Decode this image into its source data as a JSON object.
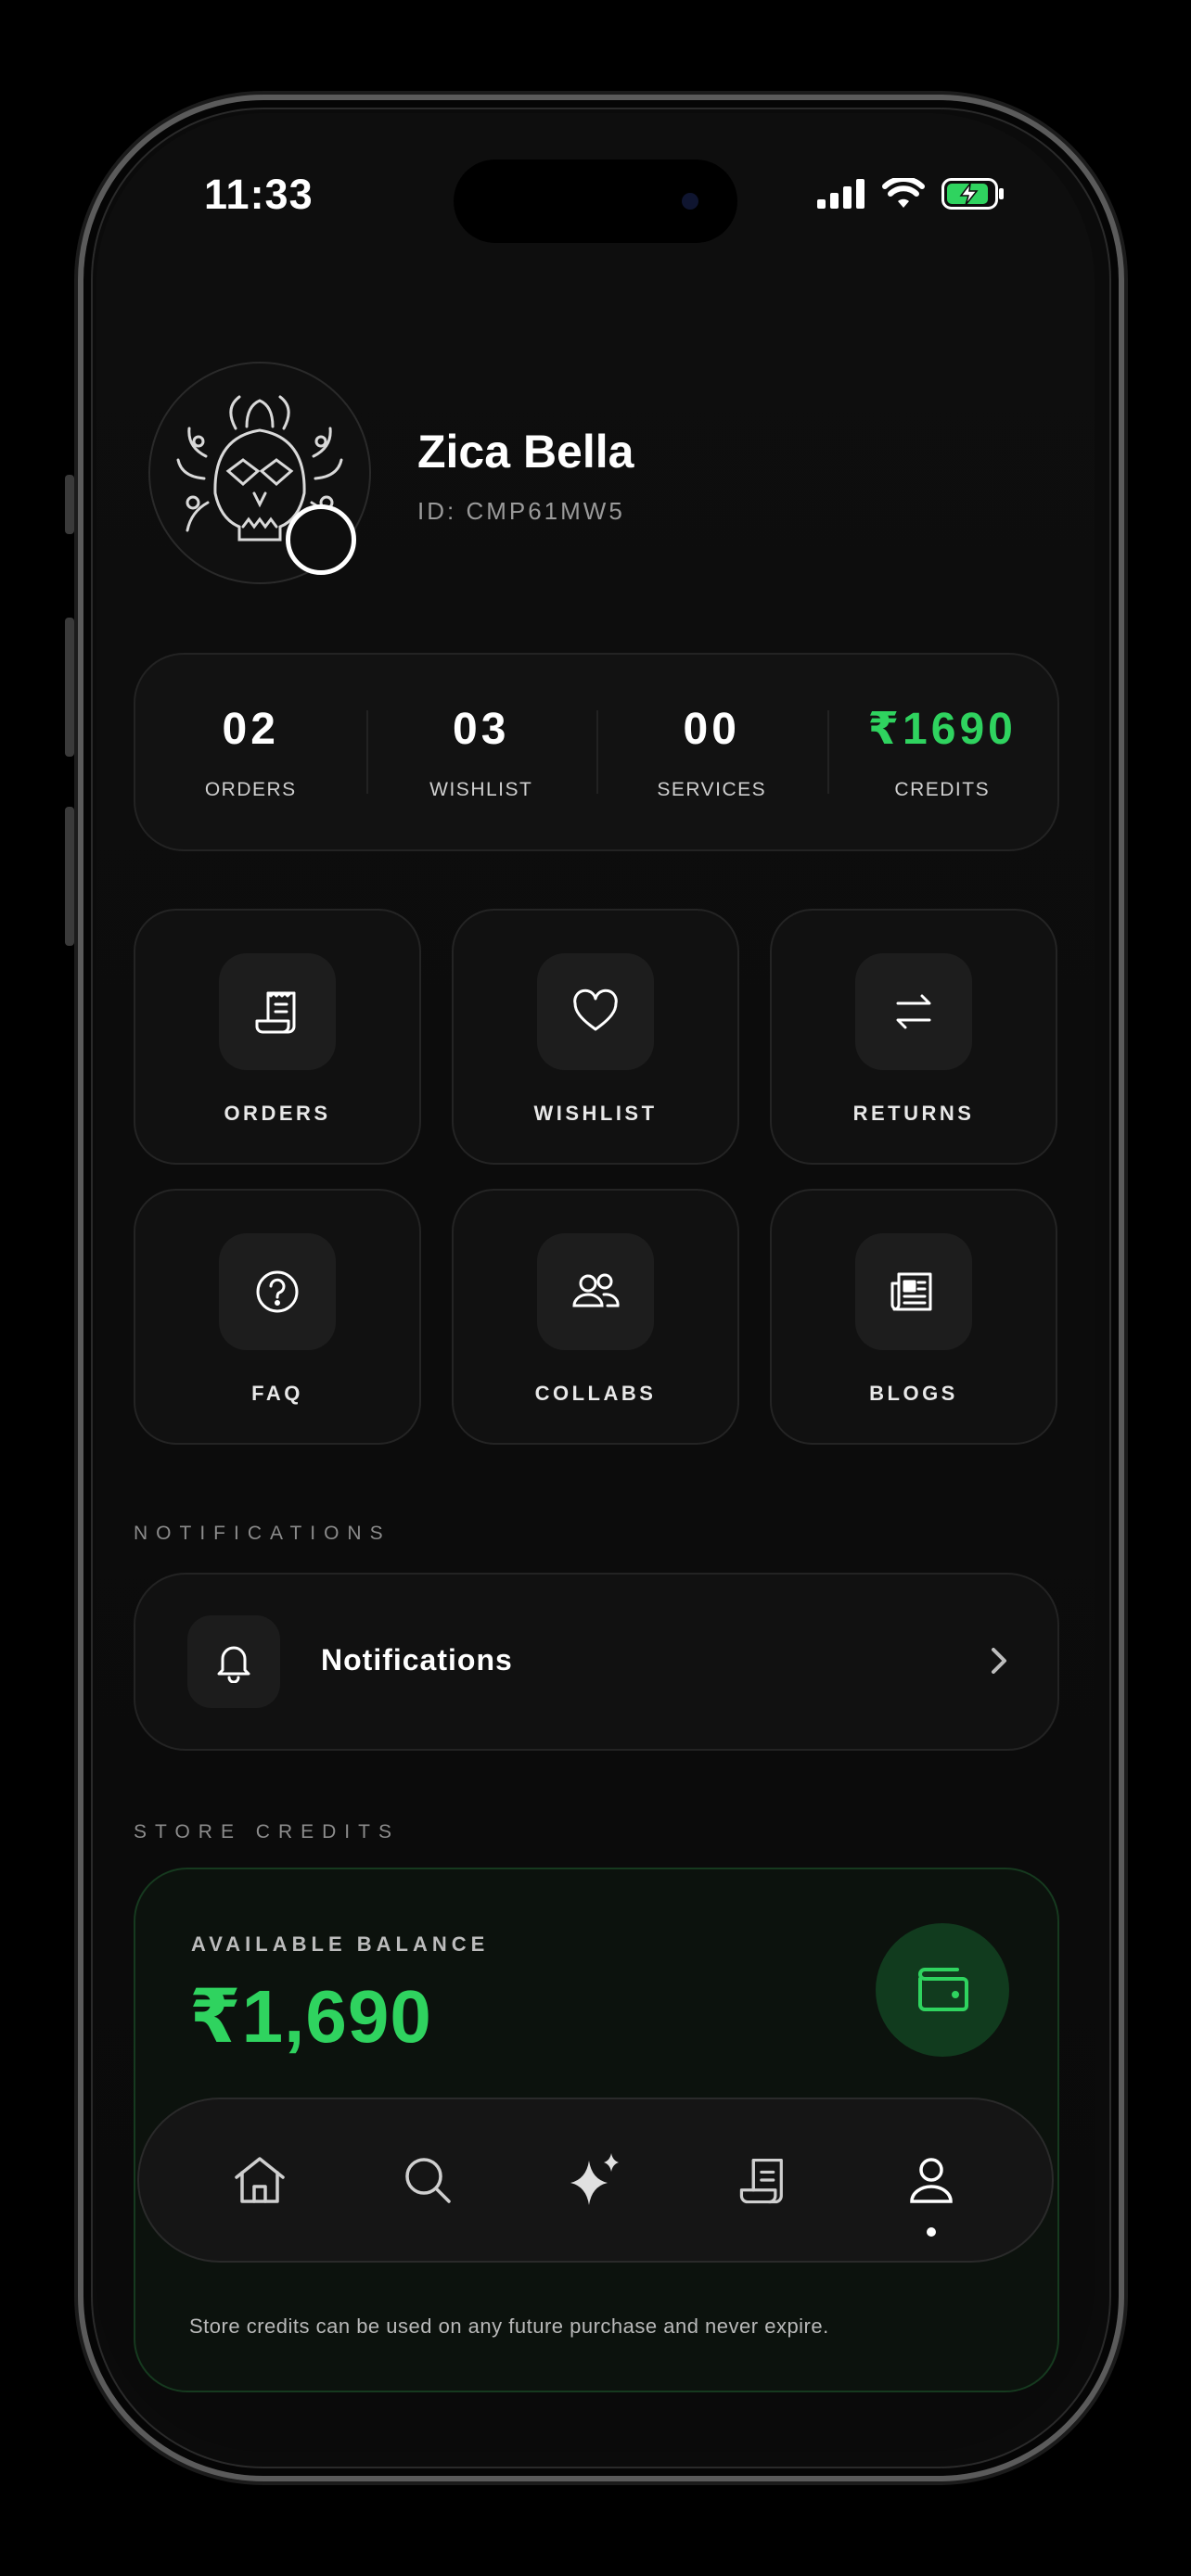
{
  "status_bar": {
    "time": "11:33"
  },
  "profile": {
    "name": "Zica Bella",
    "id": "ID: CMP61MW5"
  },
  "stats": [
    {
      "value": "02",
      "label": "ORDERS"
    },
    {
      "value": "03",
      "label": "WISHLIST"
    },
    {
      "value": "00",
      "label": "SERVICES"
    },
    {
      "value": "₹1690",
      "label": "CREDITS"
    }
  ],
  "tiles": [
    {
      "label": "ORDERS",
      "icon": "receipt-icon"
    },
    {
      "label": "WISHLIST",
      "icon": "heart-icon"
    },
    {
      "label": "RETURNS",
      "icon": "swap-arrows-icon"
    },
    {
      "label": "FAQ",
      "icon": "question-circle-icon"
    },
    {
      "label": "COLLABS",
      "icon": "users-icon"
    },
    {
      "label": "BLOGS",
      "icon": "newspaper-icon"
    }
  ],
  "notifications": {
    "section_title": "NOTIFICATIONS",
    "row_label": "Notifications"
  },
  "store_credits": {
    "section_title": "STORE CREDITS",
    "available_label": "AVAILABLE BALANCE",
    "balance": "₹1,690",
    "note": "Store credits can be used on any future purchase and never expire."
  },
  "tab_bar": {
    "items": [
      "home-icon",
      "search-icon",
      "sparkles-icon",
      "receipt-icon",
      "profile-icon"
    ],
    "active_index": 4
  },
  "colors": {
    "accent_green": "#2fd35f",
    "background": "#0b0b0b"
  }
}
